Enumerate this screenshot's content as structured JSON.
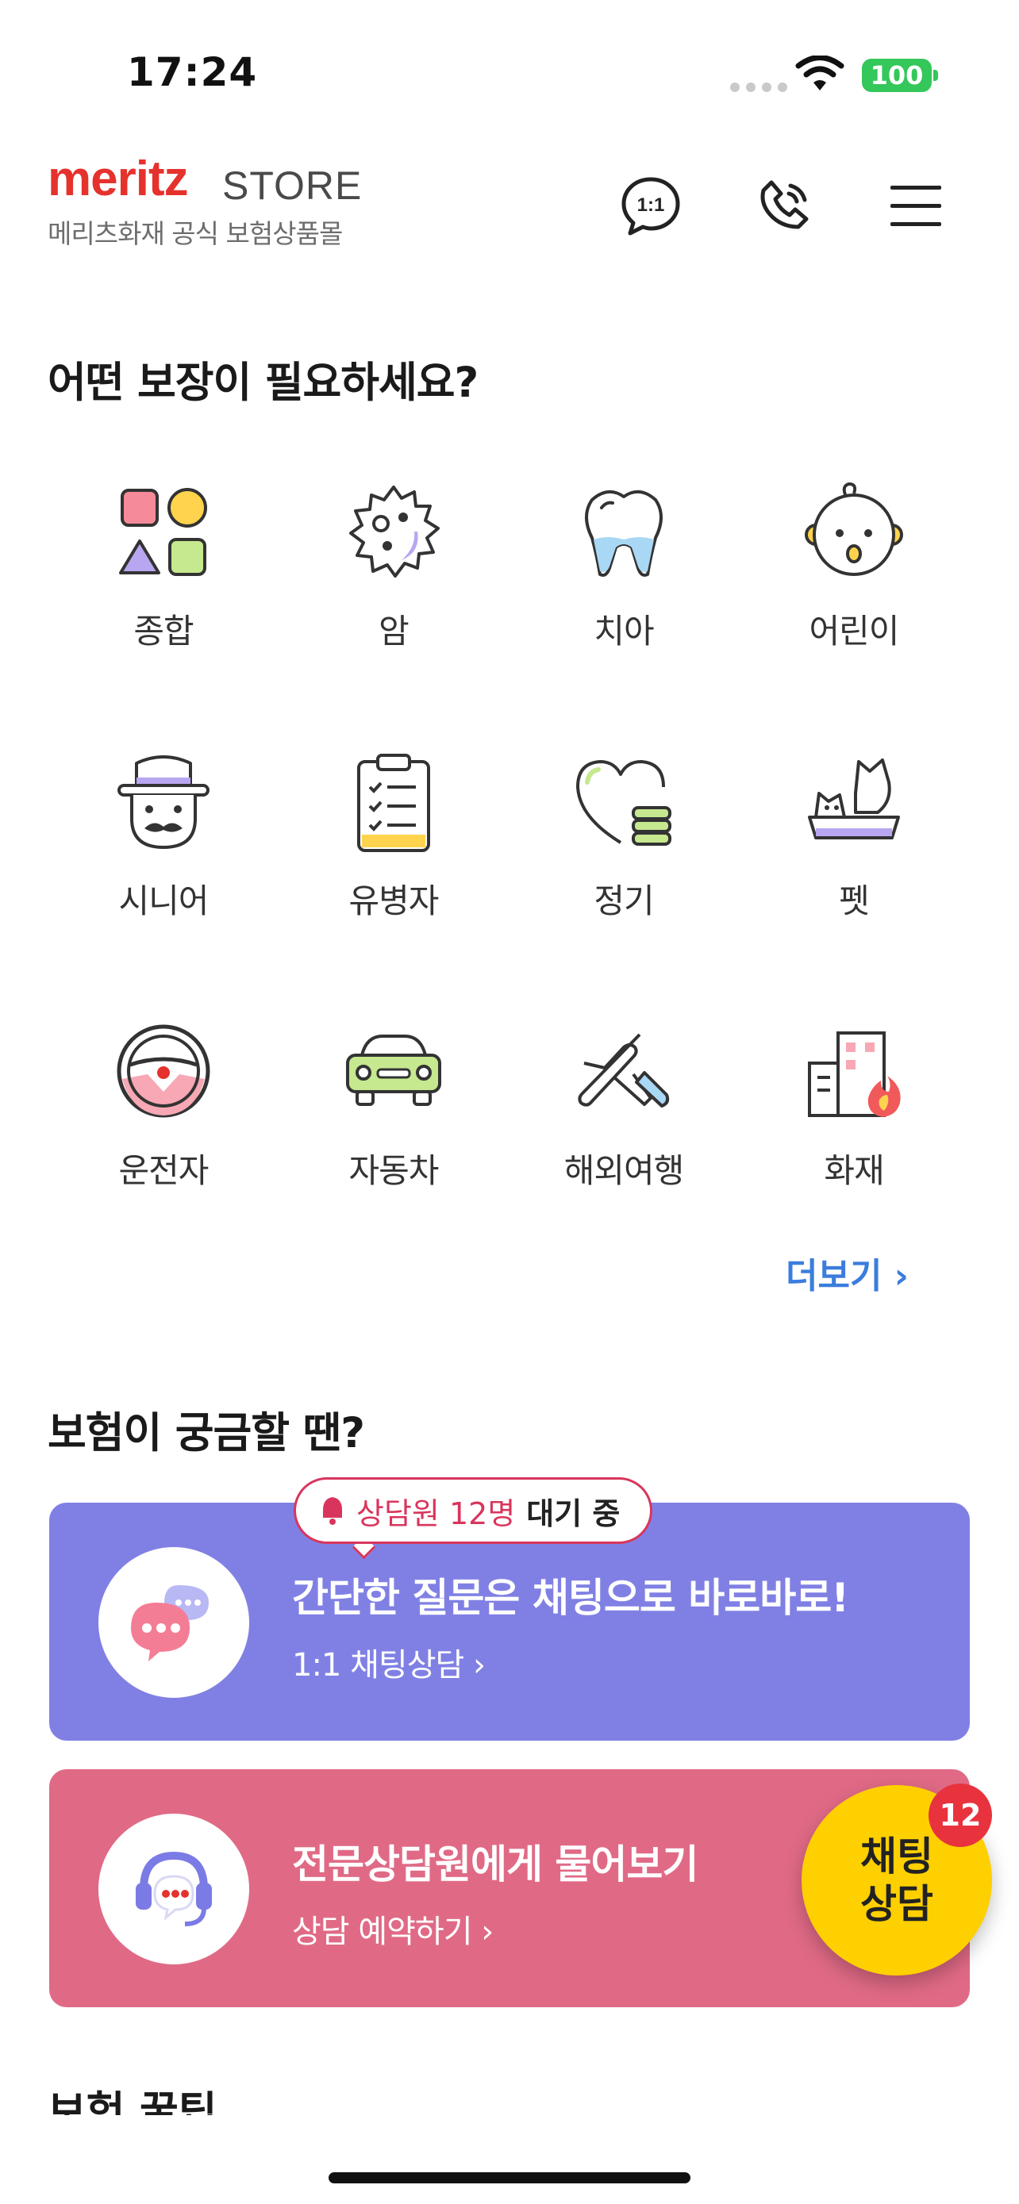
{
  "status_bar": {
    "time": "17:24",
    "battery": "100"
  },
  "header": {
    "logo_main": "meritz",
    "logo_store": "STORE",
    "logo_sub": "메리츠화재 공식 보험상품몰"
  },
  "coverage": {
    "title": "어떤 보장이 필요하세요?",
    "items": [
      {
        "label": "종합"
      },
      {
        "label": "암"
      },
      {
        "label": "치아"
      },
      {
        "label": "어린이"
      },
      {
        "label": "시니어"
      },
      {
        "label": "유병자"
      },
      {
        "label": "정기"
      },
      {
        "label": "펫"
      },
      {
        "label": "운전자"
      },
      {
        "label": "자동차"
      },
      {
        "label": "해외여행"
      },
      {
        "label": "화재"
      }
    ],
    "more": "더보기 ›"
  },
  "help": {
    "title": "보험이 궁금할 땐?",
    "bubble_pink": "상담원 12명",
    "bubble_dark": "대기 중",
    "chat_card": {
      "title": "간단한 질문은 채팅으로 바로바로!",
      "sub": "1:1 채팅상담 ›"
    },
    "expert_card": {
      "title": "전문상담원에게 물어보기",
      "sub": "상담 예약하기 ›"
    }
  },
  "fab": {
    "line1": "채팅",
    "line2": "상담",
    "badge": "12"
  },
  "next_section": {
    "title": "보험 꿀팁"
  },
  "colors": {
    "brand_red": "#e5322d",
    "chat_card": "#8080e4",
    "expert_card": "#e06a86",
    "fab": "#ffd000",
    "link": "#3b7ddd"
  }
}
